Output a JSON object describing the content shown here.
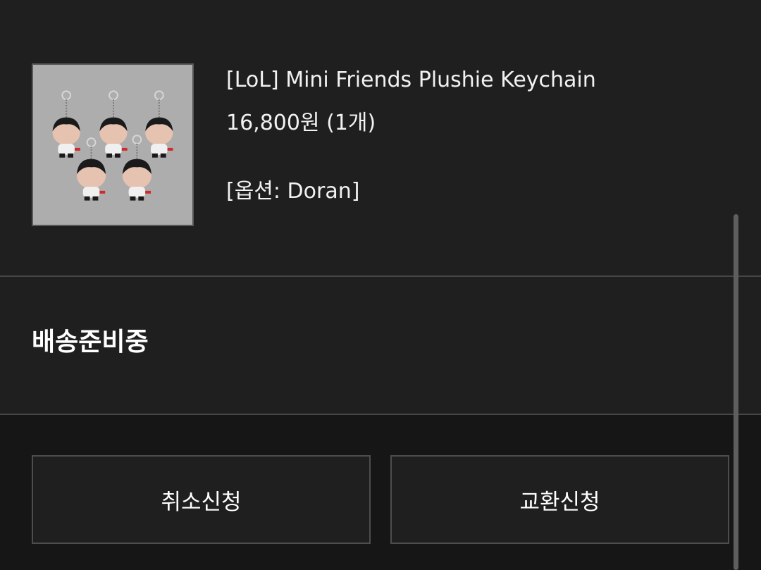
{
  "order_item": {
    "product_name": "[LoL] Mini Friends Plushie Keychain",
    "price": "16,800원 (1개)",
    "option": "[옵션: Doran]",
    "thumbnail_icon": "plushie-keychain-product-photo"
  },
  "status": {
    "label": "배송준비중"
  },
  "actions": {
    "cancel_label": "취소신청",
    "exchange_label": "교환신청"
  },
  "colors": {
    "background": "#1f1f1f",
    "action_area": "#161616",
    "divider": "#464646",
    "text": "#f2f2f2"
  }
}
